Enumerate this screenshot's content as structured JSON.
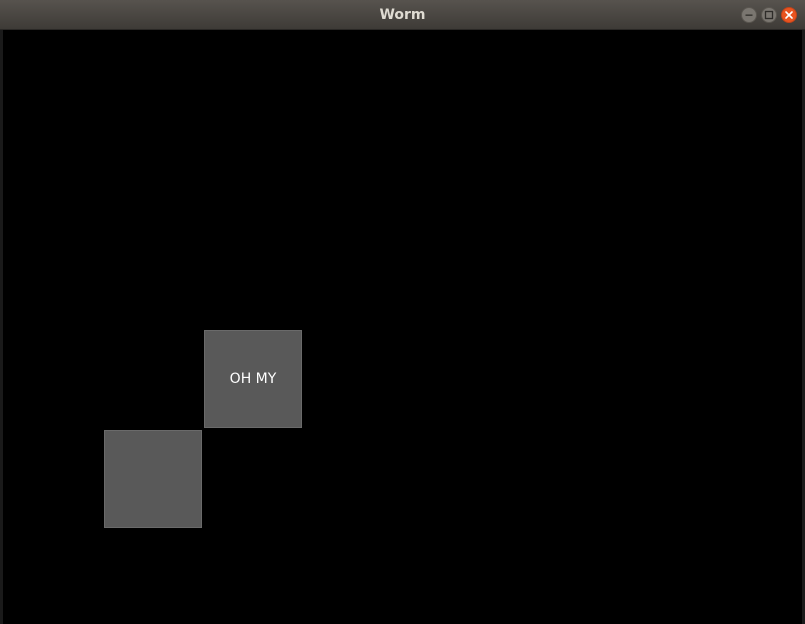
{
  "window": {
    "title": "Worm",
    "buttons": {
      "minimize": "minimize-icon",
      "maximize": "maximize-icon",
      "close": "close-icon"
    },
    "close_color": "#e95420"
  },
  "game": {
    "background": "#000000",
    "tile_color": "#595959",
    "tiles": [
      {
        "label": "OH MY"
      },
      {
        "label": ""
      }
    ]
  }
}
